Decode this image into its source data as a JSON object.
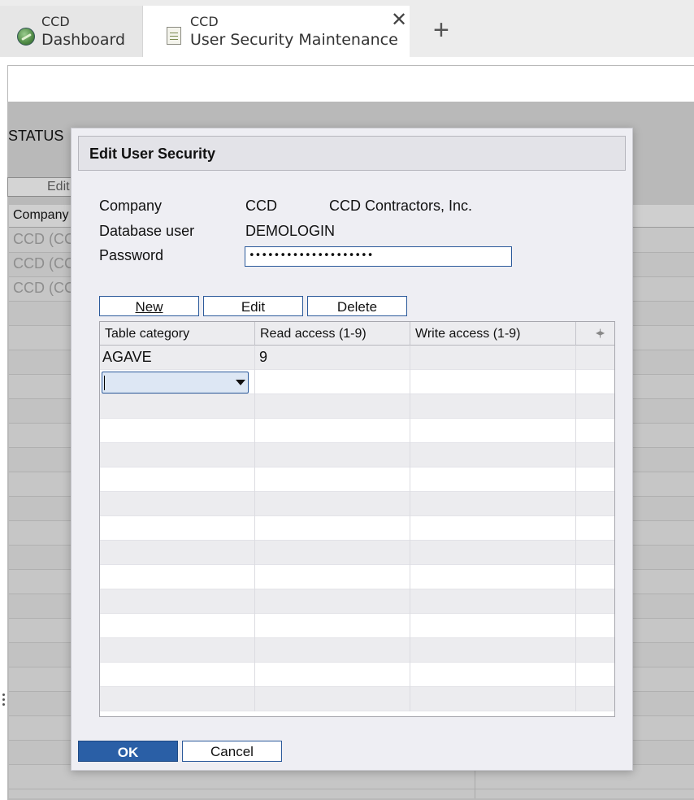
{
  "tabs": [
    {
      "sub": "CCD",
      "label": "Dashboard",
      "icon": "globe-icon"
    },
    {
      "sub": "CCD",
      "label": "User Security Maintenance",
      "icon": "document-icon",
      "close": "✕"
    }
  ],
  "add_tab": "+",
  "background": {
    "status_label": "STATUS",
    "edit_button": "Edit",
    "grid_header": "Company",
    "rows": [
      "CCD (CC",
      "CCD (CC",
      "CCD (CC"
    ]
  },
  "dialog": {
    "title": "Edit User Security",
    "company_label": "Company",
    "company_code": "CCD",
    "company_name": "CCD Contractors, Inc.",
    "dbuser_label": "Database user",
    "dbuser_value": "DEMOLOGIN",
    "password_label": "Password",
    "password_value": "••••••••••••••••••••",
    "buttons": {
      "new": "New",
      "edit": "Edit",
      "delete": "Delete"
    },
    "grid": {
      "columns": [
        "Table category",
        "Read access (1-9)",
        "Write access (1-9)"
      ],
      "rows": [
        {
          "category": "AGAVE",
          "read": "9",
          "write": ""
        }
      ]
    },
    "ok": "OK",
    "cancel": "Cancel"
  }
}
